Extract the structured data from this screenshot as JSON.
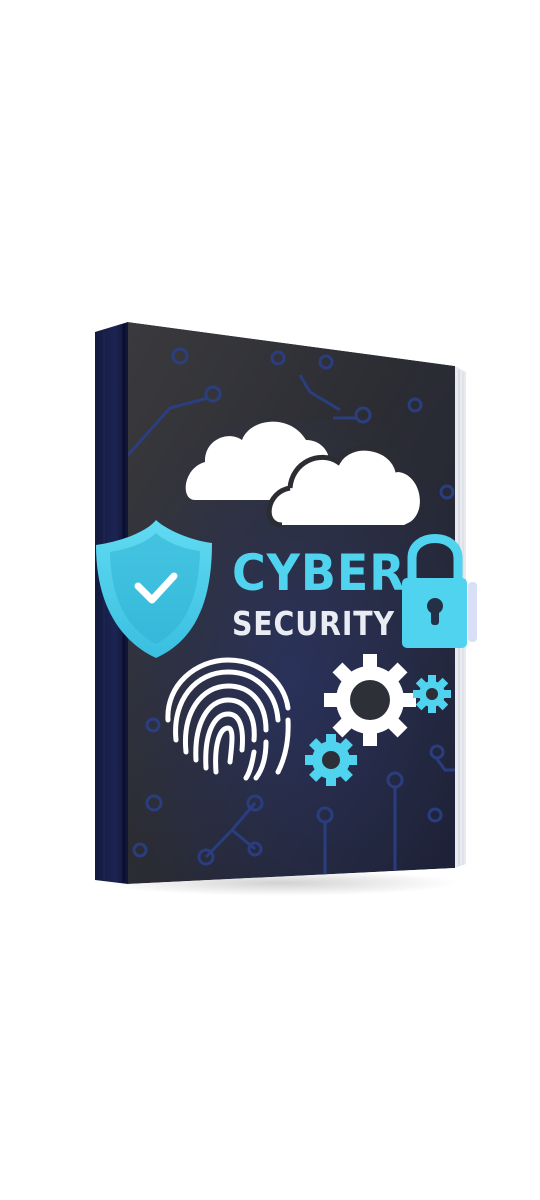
{
  "cover": {
    "title_line1": "CYBER",
    "title_line2": "SECURITY"
  },
  "icons": [
    "cloud-icon",
    "shield-check-icon",
    "padlock-icon",
    "fingerprint-icon",
    "gear-icon",
    "circuit-lines"
  ],
  "colors": {
    "background": "#ffffff",
    "cover_dark": "#2f3037",
    "spine_navy": "#1a2047",
    "accent_cyan": "#4fd3ee",
    "title_white": "#e9edf3",
    "circuit_blue": "#2b3f83"
  }
}
